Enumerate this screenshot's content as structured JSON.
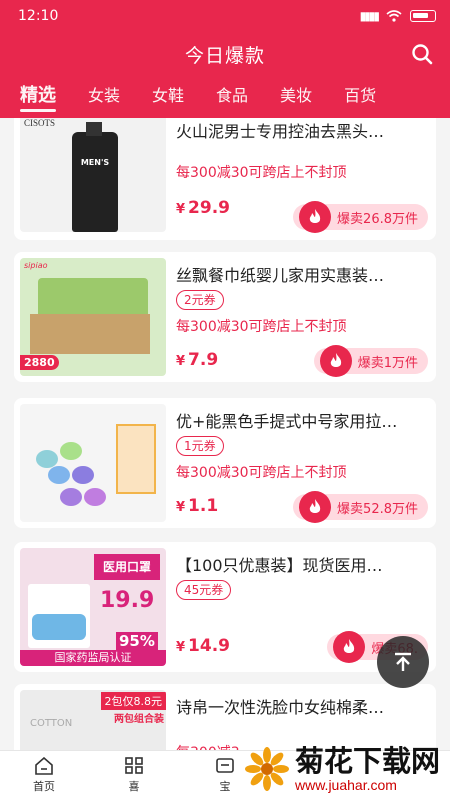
{
  "status": {
    "time": "12:10",
    "signal": "▮▮▮▮",
    "wifi": "wifi",
    "battery": "battery"
  },
  "header": {
    "title": "今日爆款"
  },
  "tabs": [
    "精选",
    "女装",
    "女鞋",
    "食品",
    "美妆",
    "百货"
  ],
  "products": [
    {
      "title": "火山泥男士专用控油去黑头…",
      "coupon": "",
      "promo": "每300减30可跨店上不封顶",
      "yen": "¥",
      "price": "29.9",
      "sales": "爆卖26.8万件",
      "thumb_text": "MEN'S",
      "thumb_brand": "CISOTS"
    },
    {
      "title": "丝飘餐巾纸婴儿家用实惠装…",
      "coupon": "2元券",
      "promo": "每300减30可跨店上不封顶",
      "yen": "¥",
      "price": "7.9",
      "sales": "爆卖1万件",
      "thumb_badge": "2880",
      "thumb_brand": "sipiao"
    },
    {
      "title": "优+能黑色手提式中号家用拉…",
      "coupon": "1元券",
      "promo": "每300减30可跨店上不封顶",
      "yen": "¥",
      "price": "1.1",
      "sales": "爆卖52.8万件"
    },
    {
      "title": "【100只优惠装】现货医用…",
      "coupon": "45元券",
      "promo": "",
      "yen": "¥",
      "price": "14.9",
      "sales": "爆卖68.",
      "thumb_top": "医用口罩",
      "thumb_price": "19.9",
      "thumb_off": "95%",
      "thumb_bottom": "国家药监局认证"
    },
    {
      "title": "诗帛一次性洗脸巾女纯棉柔…",
      "coupon": "",
      "promo": "每300减3",
      "yen": "",
      "price": "",
      "sales": "",
      "thumb_tag": "2包仅8.8元",
      "thumb_sub": "两包组合装",
      "thumb_brand": "COTTON"
    }
  ],
  "bottom_nav": [
    "首页",
    "喜",
    "宝"
  ],
  "watermark": {
    "main": "菊花下载网",
    "url": "www.juahar.com"
  },
  "colors": {
    "brand": "#e8274d"
  }
}
